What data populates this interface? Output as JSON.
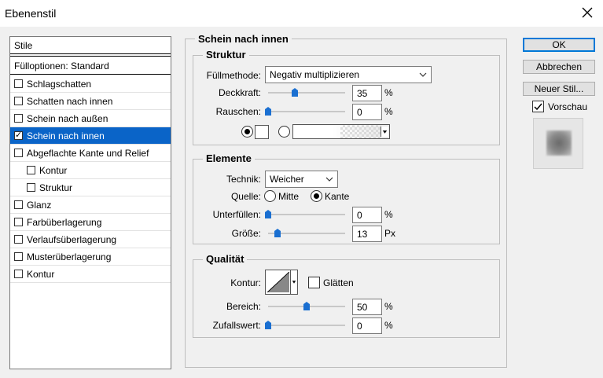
{
  "window": {
    "title": "Ebenenstil"
  },
  "styles": {
    "header": "Stile",
    "blend_options": "Fülloptionen: Standard",
    "items": [
      {
        "label": "Schlagschatten",
        "checked": false,
        "indent": false,
        "selected": false
      },
      {
        "label": "Schatten nach innen",
        "checked": false,
        "indent": false,
        "selected": false
      },
      {
        "label": "Schein nach außen",
        "checked": false,
        "indent": false,
        "selected": false
      },
      {
        "label": "Schein nach innen",
        "checked": true,
        "indent": false,
        "selected": true
      },
      {
        "label": "Abgeflachte Kante und Relief",
        "checked": false,
        "indent": false,
        "selected": false
      },
      {
        "label": "Kontur",
        "checked": false,
        "indent": true,
        "selected": false
      },
      {
        "label": "Struktur",
        "checked": false,
        "indent": true,
        "selected": false
      },
      {
        "label": "Glanz",
        "checked": false,
        "indent": false,
        "selected": false
      },
      {
        "label": "Farbüberlagerung",
        "checked": false,
        "indent": false,
        "selected": false
      },
      {
        "label": "Verlaufsüberlagerung",
        "checked": false,
        "indent": false,
        "selected": false
      },
      {
        "label": "Musterüberlagerung",
        "checked": false,
        "indent": false,
        "selected": false
      },
      {
        "label": "Kontur",
        "checked": false,
        "indent": false,
        "selected": false
      }
    ]
  },
  "panel": {
    "title": "Schein nach innen",
    "structure": {
      "title": "Struktur",
      "blend_mode_label": "Füllmethode:",
      "blend_mode_value": "Negativ multiplizieren",
      "opacity_label": "Deckkraft:",
      "opacity_value": "35",
      "opacity_unit": "%",
      "noise_label": "Rauschen:",
      "noise_value": "0",
      "noise_unit": "%"
    },
    "elements": {
      "title": "Elemente",
      "technique_label": "Technik:",
      "technique_value": "Weicher",
      "source_label": "Quelle:",
      "source_center": "Mitte",
      "source_edge": "Kante",
      "choke_label": "Unterfüllen:",
      "choke_value": "0",
      "choke_unit": "%",
      "size_label": "Größe:",
      "size_value": "13",
      "size_unit": "Px"
    },
    "quality": {
      "title": "Qualität",
      "contour_label": "Kontur:",
      "antialias_label": "Glätten",
      "range_label": "Bereich:",
      "range_value": "50",
      "range_unit": "%",
      "jitter_label": "Zufallswert:",
      "jitter_value": "0",
      "jitter_unit": "%"
    }
  },
  "buttons": {
    "ok": "OK",
    "cancel": "Abbrechen",
    "new_style": "Neuer Stil...",
    "preview_label": "Vorschau"
  },
  "colors": {
    "selection": "#0a64c8",
    "slider_thumb": "#1a6fd1"
  }
}
